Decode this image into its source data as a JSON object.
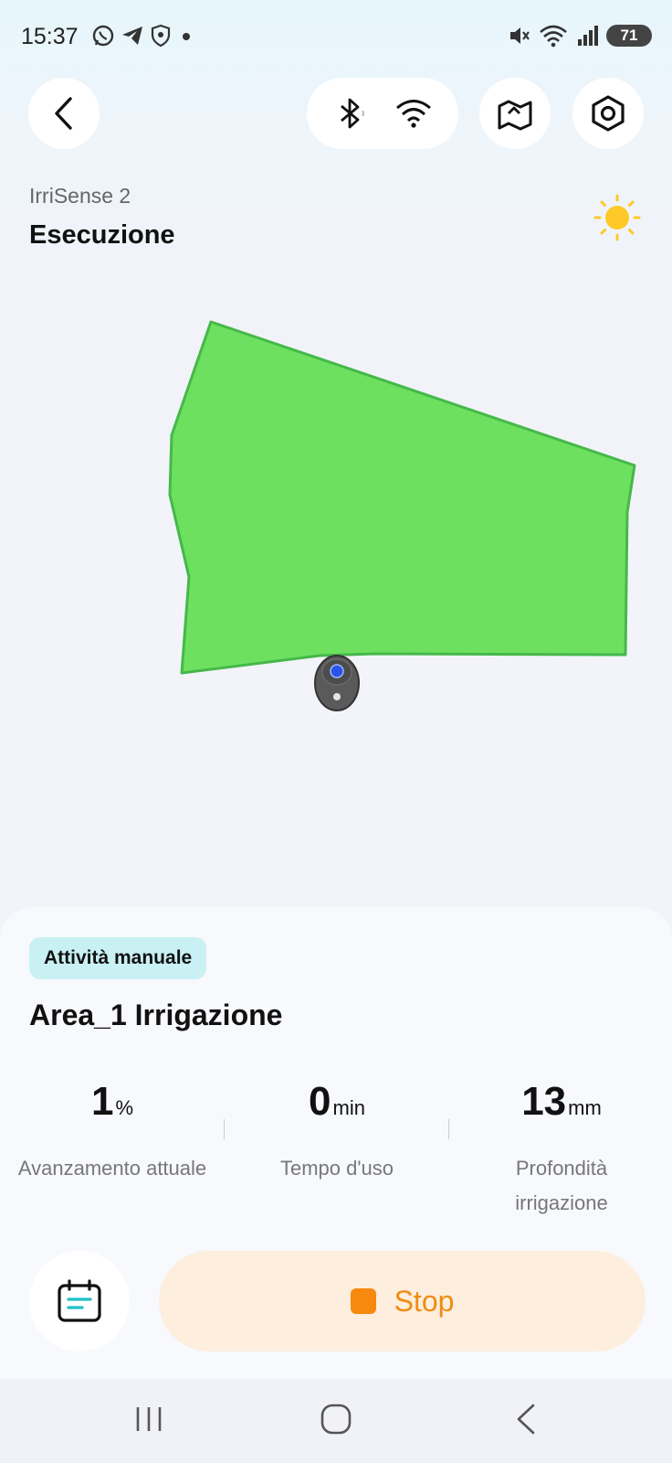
{
  "status_bar": {
    "time": "15:37",
    "battery": "71",
    "left_icons": [
      "whatsapp-icon",
      "telegram-icon",
      "shield-icon",
      "dot-icon"
    ],
    "right_icons": [
      "mute-icon",
      "wifi-icon",
      "signal-icon",
      "battery-icon"
    ]
  },
  "header": {
    "device_name": "IrriSense 2",
    "title": "Esecuzione",
    "weather_icon": "sun-icon"
  },
  "map": {
    "area_color": "#6ee05f",
    "area_border": "#45b84a",
    "device_icon": "robot-marker-icon"
  },
  "task": {
    "badge": "Attività manuale",
    "title": "Area_1 Irrigazione"
  },
  "stats": [
    {
      "value": "1",
      "unit": "%",
      "label": "Avanzamento attuale"
    },
    {
      "value": "0",
      "unit": "min",
      "label": "Tempo d'uso"
    },
    {
      "value": "13",
      "unit": "mm",
      "label": "Profondità irrigazione"
    }
  ],
  "actions": {
    "stop_label": "Stop",
    "accent": "#f08c12"
  }
}
